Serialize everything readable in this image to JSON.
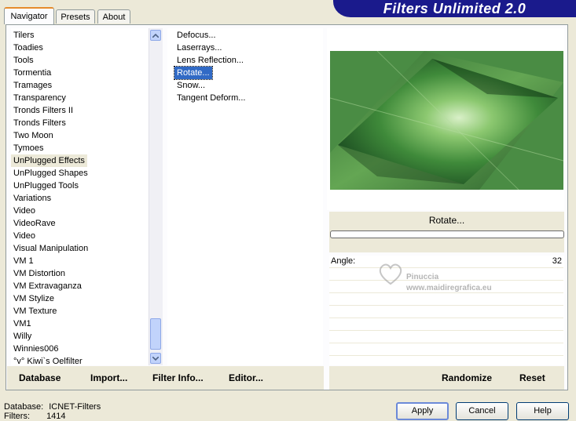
{
  "tabs": [
    {
      "label": "Navigator"
    },
    {
      "label": "Presets"
    },
    {
      "label": "About"
    }
  ],
  "banner": {
    "title": "Filters Unlimited 2.0"
  },
  "categories": [
    "Tilers",
    "Toadies",
    "Tools",
    "Tormentia",
    "Tramages",
    "Transparency",
    "Tronds Filters II",
    "Tronds Filters",
    "Two Moon",
    "Tymoes",
    "UnPlugged Effects",
    "UnPlugged Shapes",
    "UnPlugged Tools",
    "Variations",
    "Video",
    "VideoRave",
    "Video",
    "Visual Manipulation",
    "VM 1",
    "VM Distortion",
    "VM Extravaganza",
    "VM Stylize",
    "VM Texture",
    "VM1",
    "Willy",
    "Winnies006",
    "°v° Kiwi`s Oelfilter"
  ],
  "selected_category": "UnPlugged Effects",
  "filters": [
    "Defocus...",
    "Laserrays...",
    "Lens Reflection...",
    "Rotate...",
    "Snow...",
    "Tangent Deform..."
  ],
  "selected_filter": "Rotate...",
  "filter_panel": {
    "name": "Rotate...",
    "progress": 0.0
  },
  "param": {
    "label": "Angle:",
    "value": "32"
  },
  "watermark": {
    "line1": "Pinuccia",
    "line2": "www.maidiregrafica.eu"
  },
  "bottom_left": {
    "database": "Database",
    "import": "Import...",
    "filter_info": "Filter Info...",
    "editor": "Editor..."
  },
  "bottom_right": {
    "randomize": "Randomize",
    "reset": "Reset"
  },
  "status": {
    "db_label": "Database:",
    "db_value": "ICNET-Filters",
    "filters_label": "Filters:",
    "filters_value": "1414"
  },
  "buttons": {
    "apply": "Apply",
    "cancel": "Cancel",
    "help": "Help"
  }
}
